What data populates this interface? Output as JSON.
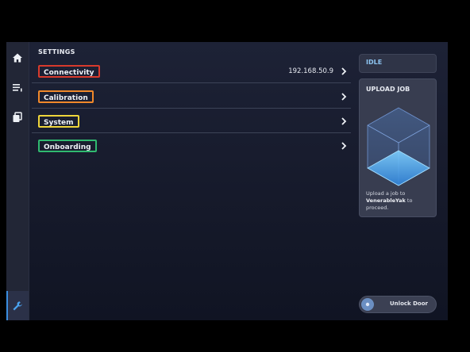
{
  "header": {
    "title": "SETTINGS"
  },
  "nav": [
    {
      "icon": "home-icon"
    },
    {
      "icon": "menu-icon"
    },
    {
      "icon": "file-icon"
    },
    {
      "icon": "wrench-icon"
    }
  ],
  "settings": {
    "connectivity": {
      "label": "Connectivity",
      "value": "192.168.50.9"
    },
    "calibration": {
      "label": "Calibration"
    },
    "system": {
      "label": "System"
    },
    "onboarding": {
      "label": "Onboarding"
    }
  },
  "status": {
    "text": "IDLE"
  },
  "upload": {
    "title": "UPLOAD JOB",
    "desc_before": "Upload a job to",
    "printer_name": "VenerableYak",
    "desc_after": "to proceed."
  },
  "door": {
    "label": "Unlock Door"
  },
  "colors": {
    "accent": "#3a8ee0",
    "connectivity_box": "#d83a2c",
    "calibration_box": "#f0882a",
    "system_box": "#efd53b",
    "onboarding_box": "#30b970"
  }
}
